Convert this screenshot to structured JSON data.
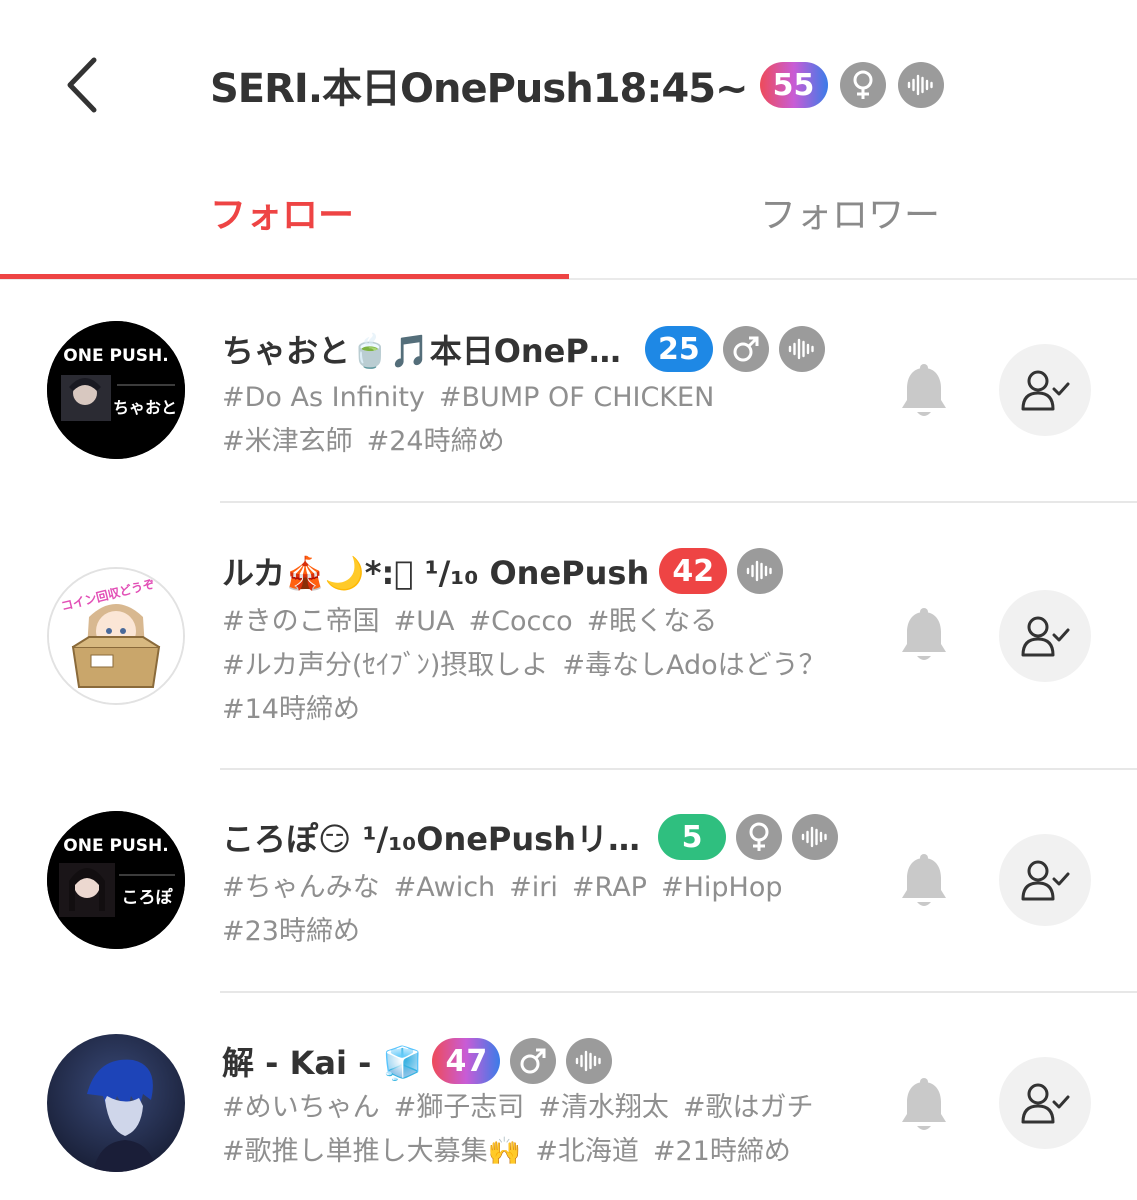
{
  "header": {
    "title": "SERI.本日OnePush18:45~",
    "level": "55",
    "level_color": "#e84a6a",
    "gender_icon": "female-icon",
    "voice_icon": "audio-wave-icon"
  },
  "tabs": {
    "follow_label": "フォロー",
    "follower_label": "フォロワー",
    "active": "follow"
  },
  "users": [
    {
      "name": "ちゃおと🍵🎵本日OneP…",
      "level": "25",
      "level_color": "#1e88e5",
      "gender": "male",
      "tags": [
        "#Do As Infinity",
        "#BUMP OF CHICKEN",
        "#米津玄師",
        "#24時締め"
      ],
      "avatar_text": "ONE PUSH.",
      "avatar_sub": "ちゃおと"
    },
    {
      "name": "ルカ🎪🌙*:゚ ¹/₁₀ OnePush",
      "level": "42",
      "level_color": "#ee4444",
      "gender": "none",
      "tags": [
        "#きのこ帝国",
        "#UA",
        "#Cocco",
        "#眠くなる",
        "#ルカ声分(ｾｲﾌﾞﾝ)摂取しよ",
        "#毒なしAdoはどう？",
        "#14時締め"
      ],
      "avatar_text": "コイン回収どうぞ"
    },
    {
      "name": "ころぽ😏 ¹/₁₀OnePushリ…",
      "level": "5",
      "level_color": "#2fbf7f",
      "gender": "female",
      "tags": [
        "#ちゃんみな",
        "#Awich",
        "#iri",
        "#RAP",
        "#HipHop",
        "#23時締め"
      ],
      "avatar_text": "ONE PUSH.",
      "avatar_sub": "ころぽ"
    },
    {
      "name": "解 - Kai - 🧊",
      "level": "47",
      "level_color": "#e84a6a",
      "gender": "male",
      "tags": [
        "#めいちゃん",
        "#獅子志司",
        "#清水翔太",
        "#歌はガチ",
        "#歌推し単推し大募集🙌",
        "#北海道",
        "#21時締め"
      ]
    }
  ]
}
